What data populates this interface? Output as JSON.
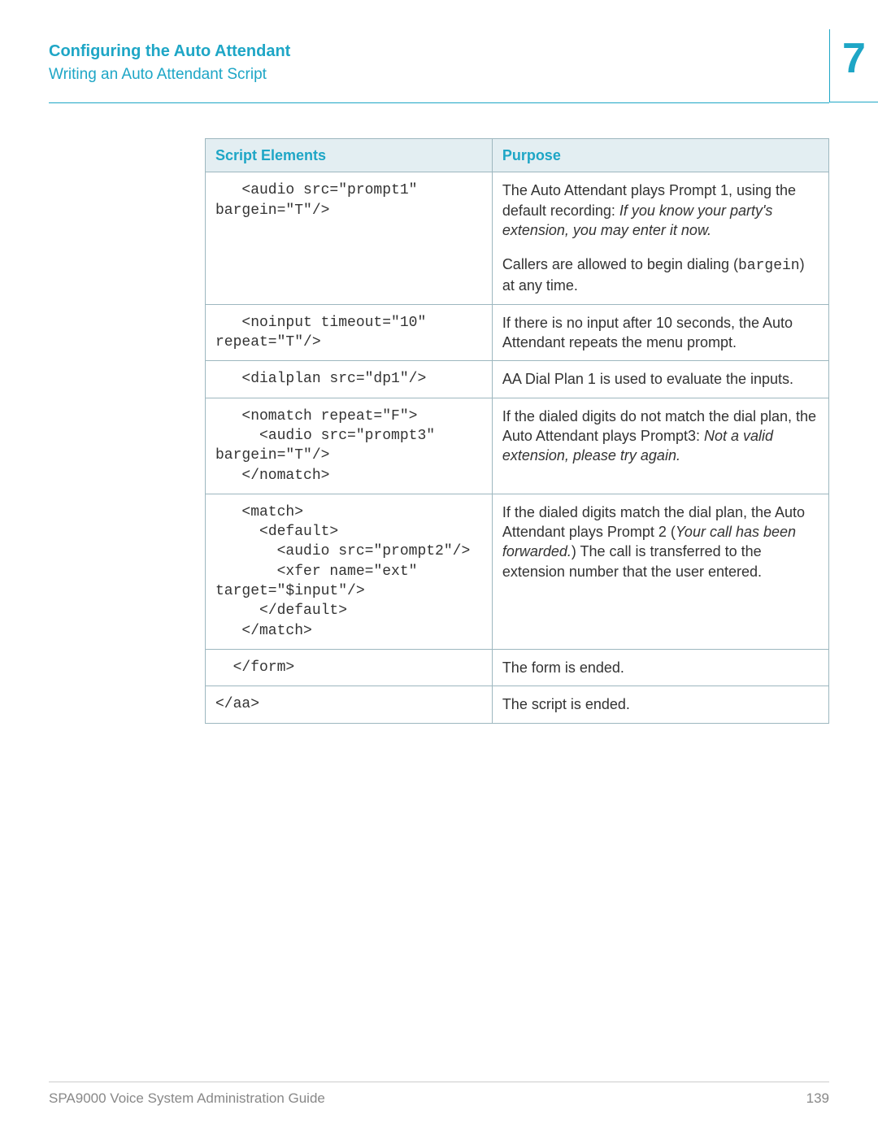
{
  "header": {
    "chapter_title": "Configuring the Auto Attendant",
    "section_title": "Writing an Auto Attendant Script",
    "chapter_number": "7"
  },
  "table": {
    "headers": {
      "col1": "Script Elements",
      "col2": "Purpose"
    },
    "rows": [
      {
        "code": "   <audio src=\"prompt1\"\nbargein=\"T\"/>",
        "purpose_p1_a": "The Auto Attendant plays Prompt 1, using the default recording: ",
        "purpose_p1_b": "If you know your party's extension, you may enter it now.",
        "purpose_p2_a": "Callers are allowed to begin dialing (",
        "purpose_p2_b": "bargein",
        "purpose_p2_c": ") at any time."
      },
      {
        "code": "   <noinput timeout=\"10\"\nrepeat=\"T\"/>",
        "purpose": "If there is no input after 10 seconds, the Auto Attendant repeats the menu prompt."
      },
      {
        "code": "   <dialplan src=\"dp1\"/>",
        "purpose": "AA Dial Plan 1 is used to evaluate the inputs."
      },
      {
        "code": "   <nomatch repeat=\"F\">\n     <audio src=\"prompt3\"\nbargein=\"T\"/>\n   </nomatch>",
        "purpose_a": "If the dialed digits do not match the dial plan, the Auto Attendant plays Prompt3: ",
        "purpose_b": "Not a valid extension, please try again."
      },
      {
        "code": "   <match>\n     <default>\n       <audio src=\"prompt2\"/>\n       <xfer name=\"ext\"\ntarget=\"$input\"/>\n     </default>\n   </match>",
        "purpose_a": "If the dialed digits match the dial plan, the Auto Attendant plays Prompt 2 (",
        "purpose_b": "Your call has been forwarded.",
        "purpose_c": ") The call is transferred to the extension number that the user entered."
      },
      {
        "code": "  </form>",
        "purpose": "The form is ended."
      },
      {
        "code": "</aa>",
        "purpose": "The script is ended."
      }
    ]
  },
  "footer": {
    "doc_title": "SPA9000 Voice System Administration Guide",
    "page_number": "139"
  }
}
